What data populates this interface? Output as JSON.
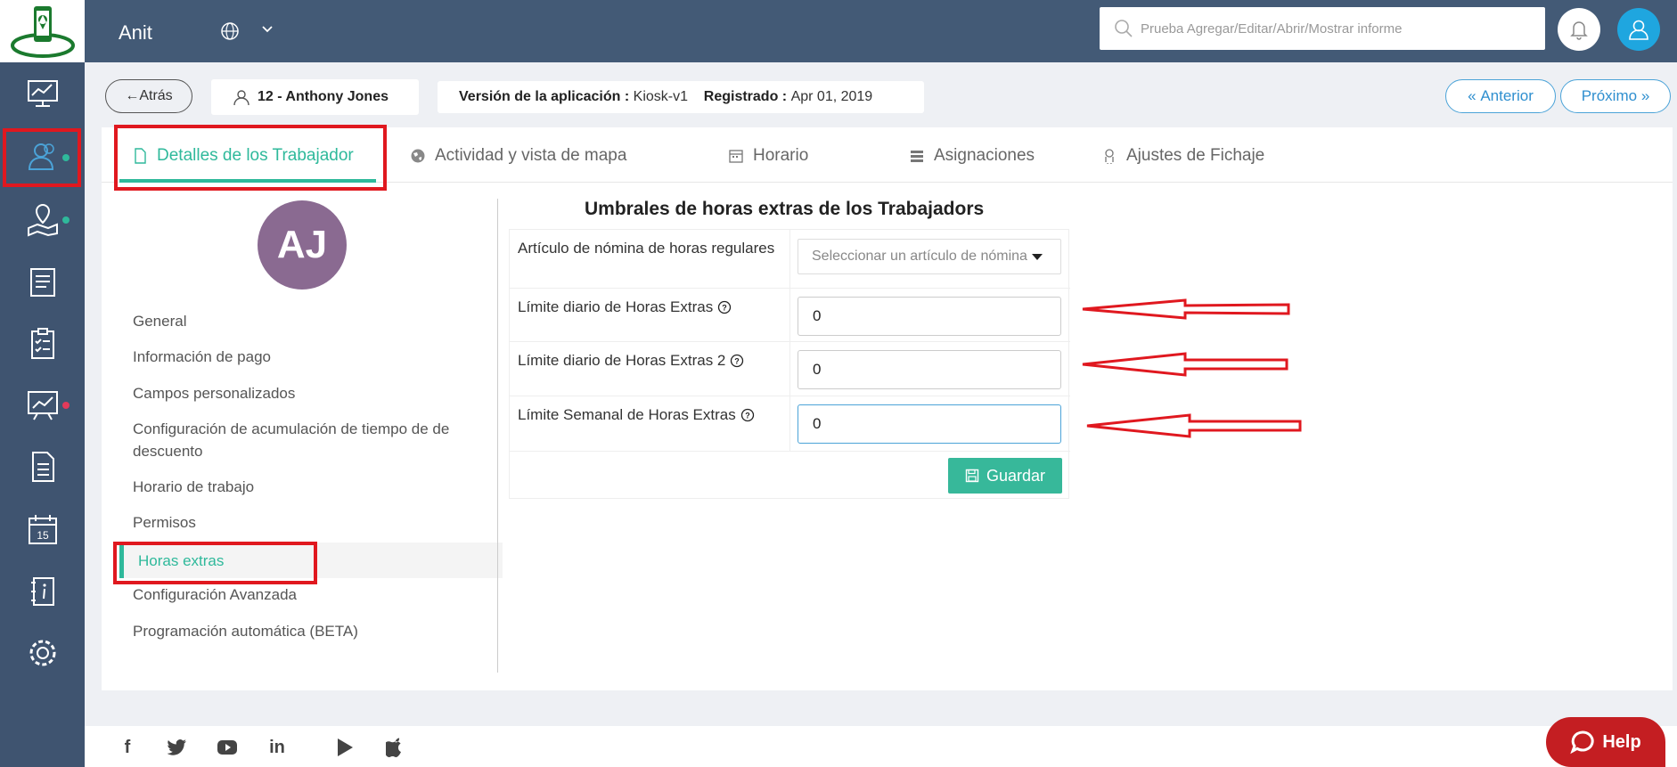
{
  "topbar": {
    "app_name": "Anit",
    "search_placeholder": "Prueba Agregar/Editar/Abrir/Mostrar informe"
  },
  "subheader": {
    "back_label": "Atrás",
    "worker": "12 - Anthony Jones",
    "version_label": "Versión de la aplicación :",
    "version_value": "Kiosk-v1",
    "registered_label": "Registrado :",
    "registered_value": "Apr 01, 2019",
    "prev_label": "Anterior",
    "next_label": "Próximo"
  },
  "tabs": [
    {
      "label": "Detalles de los Trabajador",
      "icon": "document-icon",
      "active": true
    },
    {
      "label": "Actividad y vista de mapa",
      "icon": "globe-icon",
      "active": false
    },
    {
      "label": "Horario",
      "icon": "calendar-icon",
      "active": false
    },
    {
      "label": "Asignaciones",
      "icon": "list-icon",
      "active": false
    },
    {
      "label": "Ajustes de Fichaje",
      "icon": "fingerprint-icon",
      "active": false
    }
  ],
  "profile": {
    "initials": "AJ",
    "avatar_color": "#8a6a91"
  },
  "menu": [
    {
      "label": "General"
    },
    {
      "label": "Información de pago"
    },
    {
      "label": "Campos personalizados"
    },
    {
      "label": "Configuración de acumulación de tiempo de de descuento"
    },
    {
      "label": "Horario de trabajo"
    },
    {
      "label": "Permisos"
    },
    {
      "label": "Horas extras",
      "active": true
    },
    {
      "label": "Configuración Avanzada"
    },
    {
      "label": "Programación automática (BETA)"
    }
  ],
  "form": {
    "title": "Umbrales de horas extras de los Trabajadors",
    "rows": [
      {
        "label": "Artículo de nómina de horas regulares",
        "type": "select",
        "placeholder": "Seleccionar un artículo de nómina"
      },
      {
        "label": "Límite diario de Horas Extras",
        "type": "number",
        "value": "0"
      },
      {
        "label": "Límite diario de Horas Extras 2",
        "type": "number",
        "value": "0"
      },
      {
        "label": "Límite Semanal de Horas Extras",
        "type": "number",
        "value": "0"
      }
    ],
    "save_label": "Guardar"
  },
  "footer": {
    "social": [
      "facebook-icon",
      "twitter-icon",
      "youtube-icon",
      "linkedin-icon",
      "play-store-icon",
      "apple-icon"
    ]
  },
  "help_label": "Help",
  "colors": {
    "accent": "#2fb99b",
    "sidebar": "#3f5470",
    "topbar": "#435a76",
    "link_blue": "#2f8fcf",
    "annotation_red": "#e0181f",
    "help_red": "#c41e22"
  }
}
